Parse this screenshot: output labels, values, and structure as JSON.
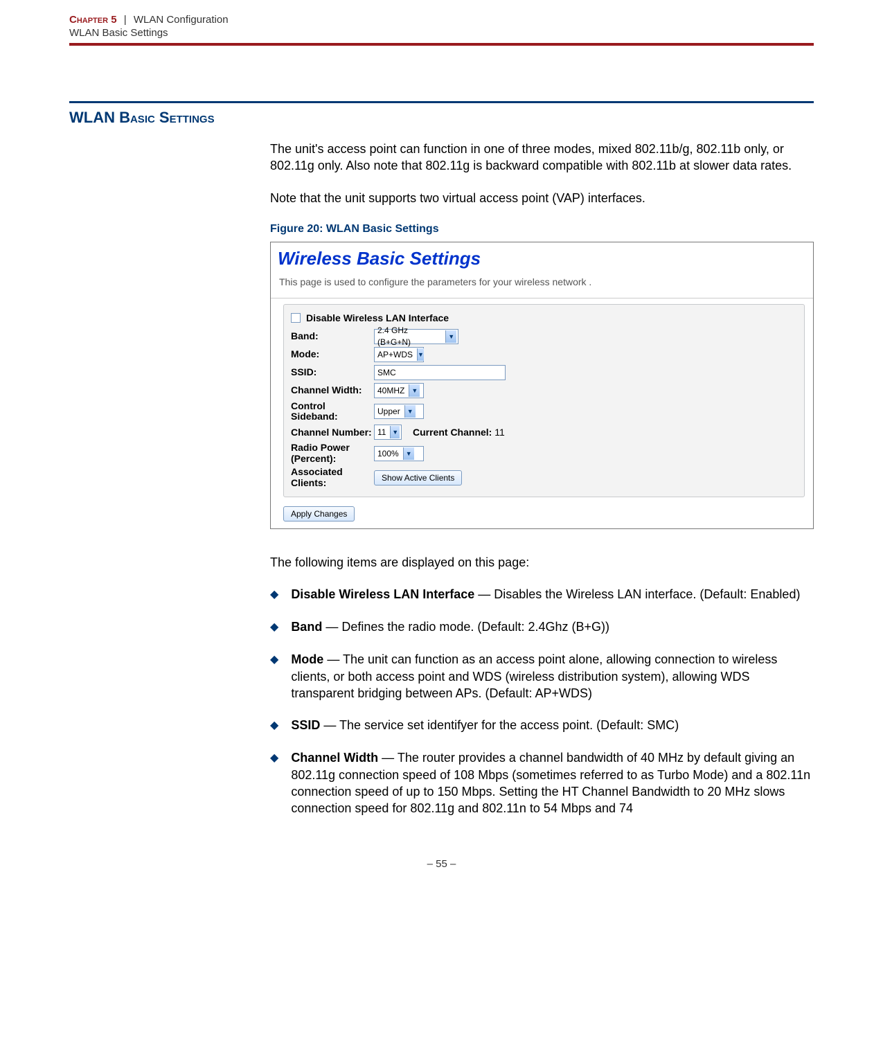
{
  "header": {
    "chapter": "Chapter 5",
    "separator": "|",
    "title": "WLAN Configuration",
    "subtitle": "WLAN Basic Settings"
  },
  "section": {
    "title": "WLAN Basic Settings"
  },
  "intro": {
    "p1": "The unit's access point can function in one of three modes, mixed 802.11b/g, 802.11b only, or 802.11g only. Also note that 802.11g is backward compatible with 802.11b at slower data rates.",
    "p2": "Note that the unit supports two virtual access point (VAP) interfaces."
  },
  "figure": {
    "caption": "Figure 20:  WLAN Basic Settings"
  },
  "screenshot": {
    "title": "Wireless Basic Settings",
    "desc": "This page is used to configure the parameters for your wireless network .",
    "disable_label": "Disable Wireless LAN Interface",
    "labels": {
      "band": "Band:",
      "mode": "Mode:",
      "ssid": "SSID:",
      "channel_width": "Channel Width:",
      "control_sideband": "Control Sideband:",
      "channel_number": "Channel Number:",
      "radio_power": "Radio Power (Percent):",
      "associated_clients": "Associated Clients:"
    },
    "values": {
      "band": "2.4 GHz (B+G+N)",
      "mode": "AP+WDS",
      "ssid": "SMC",
      "channel_width": "40MHZ",
      "control_sideband": "Upper",
      "channel_number": "11",
      "radio_power": "100%"
    },
    "current_channel_label": "Current Channel:",
    "current_channel_value": "11",
    "show_clients_btn": "Show Active Clients",
    "apply_btn": "Apply Changes"
  },
  "itemsIntro": "The following items are displayed on this page:",
  "items": [
    {
      "title": "Disable Wireless LAN Interface",
      "body": " — Disables the Wireless LAN interface. (Default: Enabled)"
    },
    {
      "title": "Band",
      "body": " — Defines the radio mode. (Default: 2.4Ghz (B+G))"
    },
    {
      "title": "Mode",
      "body": " — The unit can function as an access point alone, allowing connection to wireless clients, or both access point and WDS (wireless distribution system), allowing WDS transparent bridging between APs. (Default: AP+WDS)"
    },
    {
      "title": "SSID",
      "body": " — The service set identifyer for the access point. (Default: SMC)"
    },
    {
      "title": "Channel Width",
      "body": " — The router provides a channel bandwidth of 40 MHz by default giving an 802.11g connection speed of 108 Mbps (sometimes referred to as Turbo Mode) and a 802.11n connection speed of up to 150 Mbps. Setting the HT Channel Bandwidth to 20 MHz slows connection speed for 802.11g and 802.11n to 54 Mbps and 74"
    }
  ],
  "footer": "–  55  –",
  "chevron": "▼"
}
